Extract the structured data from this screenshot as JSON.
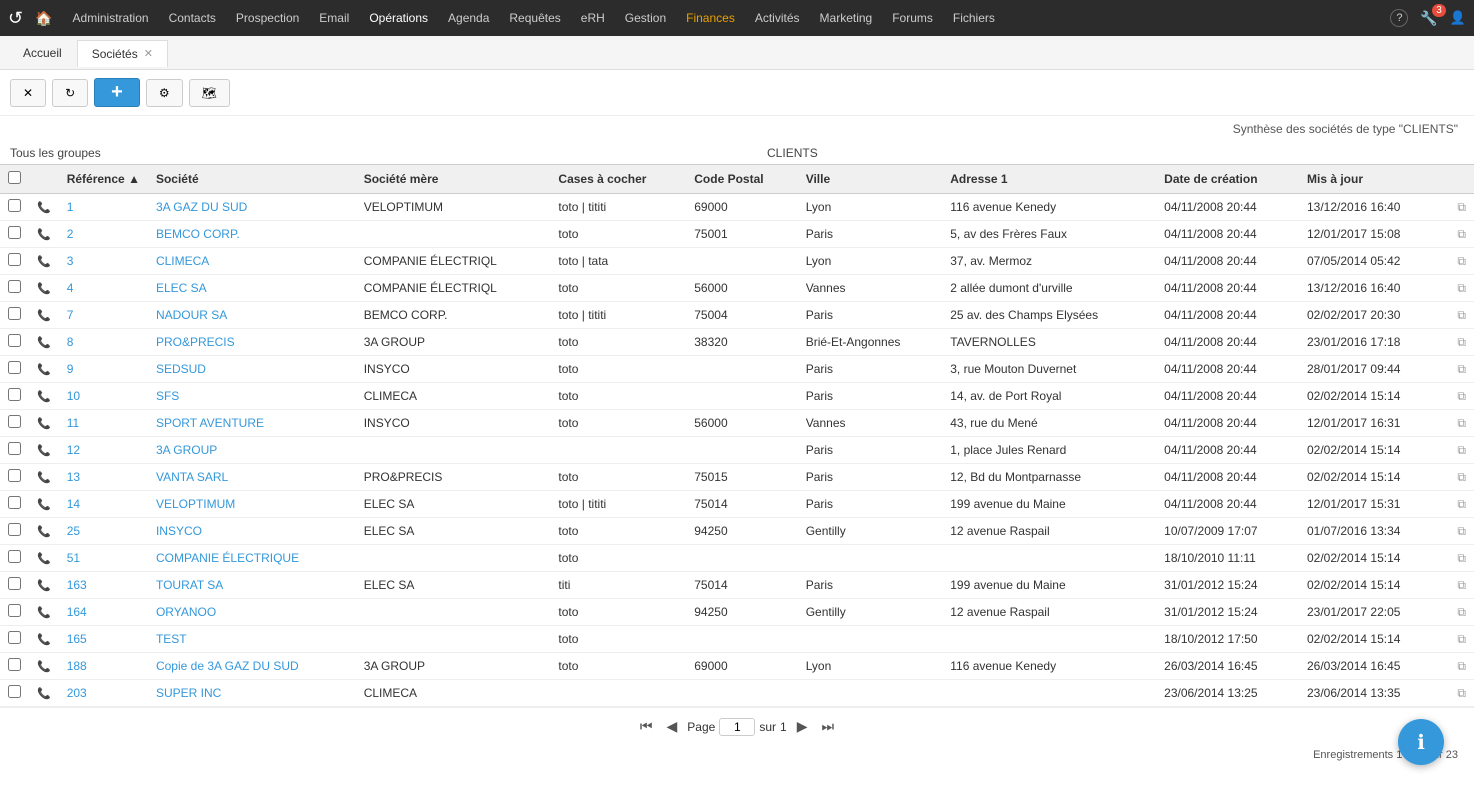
{
  "nav": {
    "logo": "↺",
    "home_icon": "🏠",
    "items": [
      {
        "label": "Administration",
        "active": false
      },
      {
        "label": "Contacts",
        "active": false
      },
      {
        "label": "Prospection",
        "active": false
      },
      {
        "label": "Email",
        "active": false
      },
      {
        "label": "Opérations",
        "active": true
      },
      {
        "label": "Agenda",
        "active": false
      },
      {
        "label": "Requêtes",
        "active": false
      },
      {
        "label": "eRH",
        "active": false
      },
      {
        "label": "Gestion",
        "active": false
      },
      {
        "label": "Finances",
        "active": false,
        "highlight": true
      },
      {
        "label": "Activités",
        "active": false
      },
      {
        "label": "Marketing",
        "active": false
      },
      {
        "label": "Forums",
        "active": false
      },
      {
        "label": "Fichiers",
        "active": false
      }
    ],
    "right": {
      "help_icon": "?",
      "tools_icon": "🔧",
      "tools_badge": "3",
      "user_icon": "👤"
    }
  },
  "tabs": [
    {
      "label": "Accueil",
      "closable": false,
      "active": false
    },
    {
      "label": "Sociétés",
      "closable": true,
      "active": true
    }
  ],
  "toolbar": {
    "clear_label": "✕",
    "refresh_label": "↻",
    "add_label": "+",
    "settings_label": "⚙",
    "map_label": "🗺"
  },
  "summary": "Synthèse des sociétés de type \"CLIENTS\"",
  "groups": {
    "left_label": "Tous les groupes",
    "right_label": "CLIENTS"
  },
  "table": {
    "columns": [
      {
        "key": "check",
        "label": ""
      },
      {
        "key": "phone",
        "label": ""
      },
      {
        "key": "ref",
        "label": "Référence ▲"
      },
      {
        "key": "societe",
        "label": "Société"
      },
      {
        "key": "mere",
        "label": "Société mère"
      },
      {
        "key": "cases",
        "label": "Cases à cocher"
      },
      {
        "key": "cp",
        "label": "Code Postal"
      },
      {
        "key": "ville",
        "label": "Ville"
      },
      {
        "key": "adresse",
        "label": "Adresse 1"
      },
      {
        "key": "creation",
        "label": "Date de création"
      },
      {
        "key": "maj",
        "label": "Mis à jour"
      },
      {
        "key": "copy",
        "label": ""
      }
    ],
    "rows": [
      {
        "ref": "1",
        "societe": "3A GAZ DU SUD",
        "mere": "VELOPTIMUM",
        "cases": "toto | tititi",
        "cp": "69000",
        "ville": "Lyon",
        "adresse": "116 avenue Kenedy",
        "creation": "04/11/2008 20:44",
        "maj": "13/12/2016 16:40"
      },
      {
        "ref": "2",
        "societe": "BEMCO CORP.",
        "mere": "",
        "cases": "toto",
        "cp": "75001",
        "ville": "Paris",
        "adresse": "5, av des Frères Faux",
        "creation": "04/11/2008 20:44",
        "maj": "12/01/2017 15:08"
      },
      {
        "ref": "3",
        "societe": "CLIMECA",
        "mere": "COMPANIE ÉLECTRIQL",
        "cases": "toto | tata",
        "cp": "",
        "ville": "Lyon",
        "adresse": "37, av. Mermoz",
        "creation": "04/11/2008 20:44",
        "maj": "07/05/2014 05:42"
      },
      {
        "ref": "4",
        "societe": "ELEC SA",
        "mere": "COMPANIE ÉLECTRIQL",
        "cases": "toto",
        "cp": "56000",
        "ville": "Vannes",
        "adresse": "2 allée dumont d'urville",
        "creation": "04/11/2008 20:44",
        "maj": "13/12/2016 16:40"
      },
      {
        "ref": "7",
        "societe": "NADOUR SA",
        "mere": "BEMCO CORP.",
        "cases": "toto | tititi",
        "cp": "75004",
        "ville": "Paris",
        "adresse": "25 av. des Champs Elysées",
        "creation": "04/11/2008 20:44",
        "maj": "02/02/2017 20:30"
      },
      {
        "ref": "8",
        "societe": "PRO&PRECIS",
        "mere": "3A GROUP",
        "cases": "toto",
        "cp": "38320",
        "ville": "Brié-Et-Angonnes",
        "adresse": "TAVERNOLLES",
        "creation": "04/11/2008 20:44",
        "maj": "23/01/2016 17:18"
      },
      {
        "ref": "9",
        "societe": "SEDSUD",
        "mere": "INSYCO",
        "cases": "toto",
        "cp": "",
        "ville": "Paris",
        "adresse": "3, rue Mouton Duvernet",
        "creation": "04/11/2008 20:44",
        "maj": "28/01/2017 09:44"
      },
      {
        "ref": "10",
        "societe": "SFS",
        "mere": "CLIMECA",
        "cases": "toto",
        "cp": "",
        "ville": "Paris",
        "adresse": "14, av. de Port Royal",
        "creation": "04/11/2008 20:44",
        "maj": "02/02/2014 15:14"
      },
      {
        "ref": "11",
        "societe": "SPORT AVENTURE",
        "mere": "INSYCO",
        "cases": "toto",
        "cp": "56000",
        "ville": "Vannes",
        "adresse": "43, rue du Mené",
        "creation": "04/11/2008 20:44",
        "maj": "12/01/2017 16:31"
      },
      {
        "ref": "12",
        "societe": "3A GROUP",
        "mere": "",
        "cases": "",
        "cp": "",
        "ville": "Paris",
        "adresse": "1, place Jules Renard",
        "creation": "04/11/2008 20:44",
        "maj": "02/02/2014 15:14"
      },
      {
        "ref": "13",
        "societe": "VANTA SARL",
        "mere": "PRO&PRECIS",
        "cases": "toto",
        "cp": "75015",
        "ville": "Paris",
        "adresse": "12, Bd du Montparnasse",
        "creation": "04/11/2008 20:44",
        "maj": "02/02/2014 15:14"
      },
      {
        "ref": "14",
        "societe": "VELOPTIMUM",
        "mere": "ELEC SA",
        "cases": "toto | tititi",
        "cp": "75014",
        "ville": "Paris",
        "adresse": "199 avenue du Maine",
        "creation": "04/11/2008 20:44",
        "maj": "12/01/2017 15:31"
      },
      {
        "ref": "25",
        "societe": "INSYCO",
        "mere": "ELEC SA",
        "cases": "toto",
        "cp": "94250",
        "ville": "Gentilly",
        "adresse": "12 avenue Raspail",
        "creation": "10/07/2009 17:07",
        "maj": "01/07/2016 13:34"
      },
      {
        "ref": "51",
        "societe": "COMPANIE ÉLECTRIQUE",
        "mere": "",
        "cases": "toto",
        "cp": "",
        "ville": "",
        "adresse": "",
        "creation": "18/10/2010 11:11",
        "maj": "02/02/2014 15:14"
      },
      {
        "ref": "163",
        "societe": "TOURAT SA",
        "mere": "ELEC SA",
        "cases": "titi",
        "cp": "75014",
        "ville": "Paris",
        "adresse": "199 avenue du Maine",
        "creation": "31/01/2012 15:24",
        "maj": "02/02/2014 15:14"
      },
      {
        "ref": "164",
        "societe": "ORYANOO",
        "mere": "",
        "cases": "toto",
        "cp": "94250",
        "ville": "Gentilly",
        "adresse": "12 avenue Raspail",
        "creation": "31/01/2012 15:24",
        "maj": "23/01/2017 22:05"
      },
      {
        "ref": "165",
        "societe": "TEST",
        "mere": "",
        "cases": "toto",
        "cp": "",
        "ville": "",
        "adresse": "",
        "creation": "18/10/2012 17:50",
        "maj": "02/02/2014 15:14"
      },
      {
        "ref": "188",
        "societe": "Copie de 3A GAZ DU SUD",
        "mere": "3A GROUP",
        "cases": "toto",
        "cp": "69000",
        "ville": "Lyon",
        "adresse": "116 avenue Kenedy",
        "creation": "26/03/2014 16:45",
        "maj": "26/03/2014 16:45"
      },
      {
        "ref": "203",
        "societe": "SUPER INC",
        "mere": "CLIMECA",
        "cases": "",
        "cp": "",
        "ville": "",
        "adresse": "",
        "creation": "23/06/2014 13:25",
        "maj": "23/06/2014 13:35"
      }
    ]
  },
  "pagination": {
    "first_icon": "⏮",
    "prev_icon": "◀",
    "next_icon": "▶",
    "last_icon": "⏭",
    "page_label": "Page",
    "page_value": "1",
    "sur_label": "sur",
    "total_pages": "1"
  },
  "records_info": "Enregistrements 1 - 23 sur 23",
  "fab": {
    "icon": "ℹ"
  }
}
